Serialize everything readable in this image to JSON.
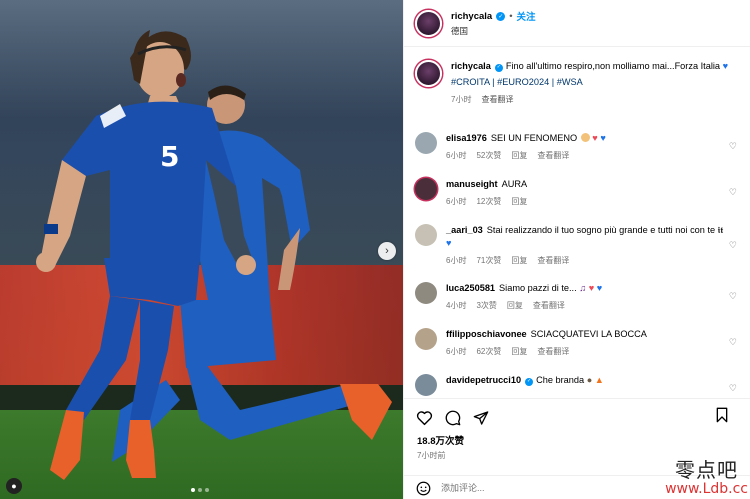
{
  "post": {
    "username": "richycala",
    "follow_label": "关注",
    "location": "德国",
    "caption_text": "Fino all'ultimo respiro,non molliamo mai...Forza Italia",
    "hashtags": "#CROITA | #EURO2024 | #WSA",
    "caption_time": "7小时",
    "caption_translate": "查看翻译",
    "likes": "18.8万次赞",
    "post_time": "7小时前",
    "comment_placeholder": "添加评论..."
  },
  "photo": {
    "jersey_number": "5"
  },
  "comments": [
    {
      "user": "elisa1976",
      "text": "SEI UN FENOMENO",
      "time": "6小时",
      "likes": "52次赞",
      "reply": "回复",
      "translate": "查看翻译",
      "avatar_color": "#9aa7b0"
    },
    {
      "user": "manuseight",
      "text": "AURA",
      "time": "6小时",
      "likes": "12次赞",
      "reply": "回复",
      "translate": "",
      "avatar_color": "#4a2f3a"
    },
    {
      "user": "_aari_03",
      "text": "Stai realizzando il tuo sogno più grande e tutti noi con te ",
      "text_suffix": "𝖎𝖙",
      "time": "6小时",
      "likes": "71次赞",
      "reply": "回复",
      "translate": "查看翻译",
      "avatar_color": "#c7c0b4"
    },
    {
      "user": "luca250581",
      "text": "Siamo pazzi di te...",
      "time": "4小时",
      "likes": "3次赞",
      "reply": "回复",
      "translate": "查看翻译",
      "avatar_color": "#8f8a80"
    },
    {
      "user": "ffilipposchiavonee",
      "text": "SCIACQUATEVI LA BOCCA",
      "time": "6小时",
      "likes": "62次赞",
      "reply": "回复",
      "translate": "查看翻译",
      "avatar_color": "#b5a28a"
    },
    {
      "user": "davidepetrucci10",
      "text": "Che branda",
      "time": "",
      "likes": "",
      "reply": "",
      "translate": "",
      "avatar_color": "#7a8b9a"
    }
  ],
  "watermark": {
    "line1": "零点吧",
    "line2": "www.Ldb.cc"
  },
  "colors": {
    "accent": "#0095f6",
    "heart_red": "#ed4956",
    "heart_blue": "#1e73e8",
    "meta_gray": "#737373"
  },
  "icons": [
    "heart-icon",
    "comment-icon",
    "share-icon",
    "bookmark-icon",
    "emoji-icon",
    "chevron-right-icon",
    "verified-icon"
  ]
}
